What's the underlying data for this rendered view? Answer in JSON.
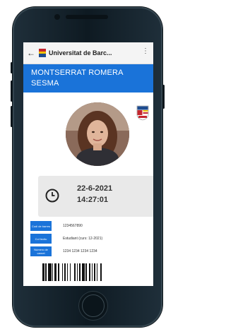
{
  "app_bar": {
    "back_icon": "arrow-left-icon",
    "title": "Universitat de Barc...",
    "menu_icon": "more-vert-icon"
  },
  "profile": {
    "name_line1": "MONTSERRAT ROMERA",
    "name_line2": "SESMA"
  },
  "validity": {
    "date": "22-6-2021",
    "time": "14:27:01",
    "icon": "clock-icon"
  },
  "details": [
    {
      "label": "Codi de barres",
      "value": "1234567890"
    },
    {
      "label": "Col·lectiu",
      "value": "Estudiant (curs: 12-2021)"
    },
    {
      "label": "Número de carnet",
      "value": "1234 1234 1234 1234"
    }
  ],
  "colors": {
    "accent": "#1a73d9",
    "phone_body": "#15232c",
    "time_panel": "#e9e9e9"
  }
}
